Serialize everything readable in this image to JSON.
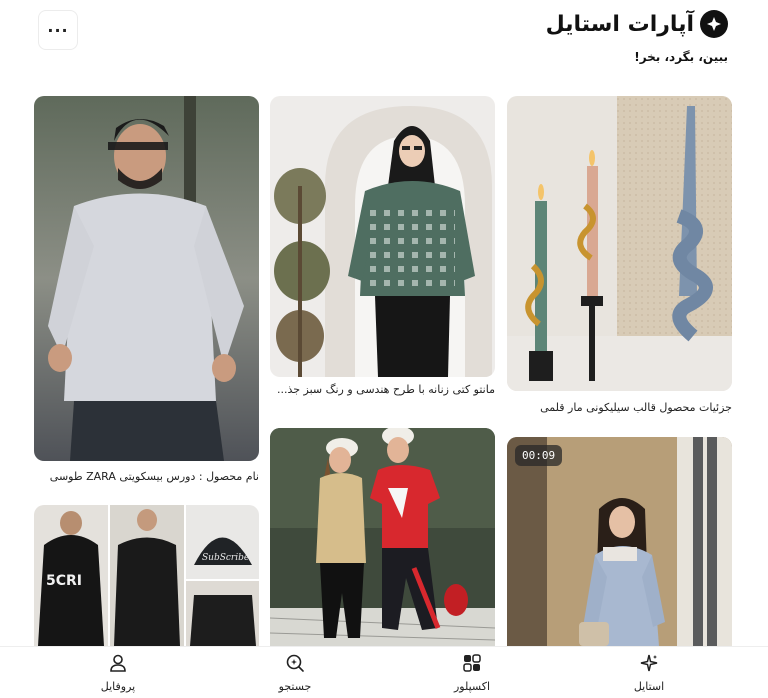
{
  "header": {
    "brand_name": "آپارات استایل",
    "tagline": "ببین، بگرد، بخر!",
    "more_label": "···"
  },
  "cards": [
    {
      "caption": "جزئیات محصول قالب سیلیکونی مار قلمی"
    },
    {
      "caption": "مانتو کتی زنانه با طرح هندسی و رنگ سبز جذ..."
    },
    {
      "caption": "نام محصول : دورس بیسکویتی ZARA طوسی"
    },
    {
      "badge": "00:09"
    }
  ],
  "bottom_nav": [
    {
      "label": "استایل",
      "icon": "sparkles-icon"
    },
    {
      "label": "اکسپلور",
      "icon": "grid-icon"
    },
    {
      "label": "جستجو",
      "icon": "search-icon"
    },
    {
      "label": "پروفایل",
      "icon": "user-icon"
    }
  ],
  "colors": {
    "accent": "#111111",
    "sweater_green": "#4f6e61",
    "tshirt_red": "#d8282e"
  }
}
